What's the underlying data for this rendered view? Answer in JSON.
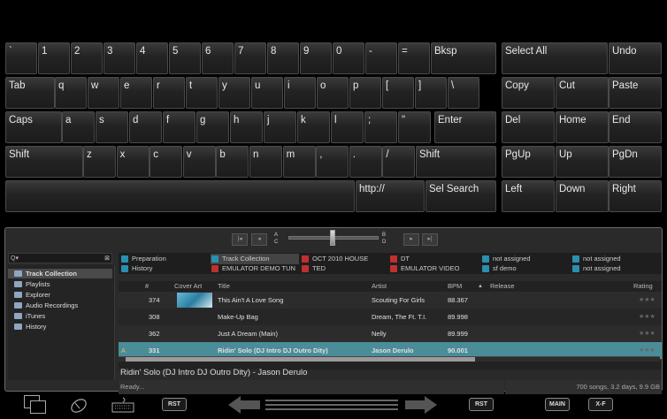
{
  "keyboard": {
    "row1": [
      "`",
      "1",
      "2",
      "3",
      "4",
      "5",
      "6",
      "7",
      "8",
      "9",
      "0",
      "-",
      "=",
      "Bksp"
    ],
    "row2": [
      "Tab",
      "q",
      "w",
      "e",
      "r",
      "t",
      "y",
      "u",
      "i",
      "o",
      "p",
      "[",
      "]",
      "\\"
    ],
    "row3": [
      "Caps",
      "a",
      "s",
      "d",
      "f",
      "g",
      "h",
      "j",
      "k",
      "l",
      ";",
      "\"",
      "Enter"
    ],
    "row4": [
      "Shift",
      "z",
      "x",
      "c",
      "v",
      "b",
      "n",
      "m",
      ",",
      ".",
      "/",
      "Shift"
    ],
    "row5": [
      "",
      "http://",
      "Sel Search"
    ],
    "edit": [
      [
        "Select All",
        "Undo"
      ],
      [
        "Copy",
        "Cut",
        "Paste"
      ],
      [
        "Del",
        "Home",
        "End"
      ],
      [
        "PgUp",
        "Up",
        "PgDn"
      ],
      [
        "Left",
        "Down",
        "Right"
      ]
    ]
  },
  "crossfader": {
    "left_letters": [
      "A",
      "C"
    ],
    "right_letters": [
      "B",
      "D"
    ]
  },
  "search": {
    "placeholder": "Q▾"
  },
  "tree": [
    "Track Collection",
    "Playlists",
    "Explorer",
    "Audio Recordings",
    "iTunes",
    "History"
  ],
  "favorites": [
    {
      "label": "Preparation",
      "color": "#2a8fb0"
    },
    {
      "label": "Track Collection",
      "color": "#2a8fb0"
    },
    {
      "label": "OCT 2010 HOUSE",
      "color": "#c03030"
    },
    {
      "label": "DT",
      "color": "#c03030"
    },
    {
      "label": "not assigned",
      "color": "#2a8fb0"
    },
    {
      "label": "not assigned",
      "color": "#2a8fb0"
    },
    {
      "label": "History",
      "color": "#2a8fb0"
    },
    {
      "label": "EMULATOR DEMO TUN",
      "color": "#c03030"
    },
    {
      "label": "TED",
      "color": "#c03030"
    },
    {
      "label": "EMULATOR VIDEO",
      "color": "#c03030"
    },
    {
      "label": "sf demo",
      "color": "#2a8fb0"
    },
    {
      "label": "not assigned",
      "color": "#2a8fb0"
    }
  ],
  "table": {
    "headers": [
      "#",
      "Cover Art",
      "Title",
      "Artist",
      "BPM",
      "▲",
      "Release",
      "Rating"
    ],
    "rows": [
      {
        "deck": "",
        "num": "374",
        "title": "This Ain't A Love Song",
        "artist": "Scouting For Girls",
        "bpm": "88.367",
        "selected": false
      },
      {
        "deck": "",
        "num": "308",
        "title": "Make-Up Bag",
        "artist": "Dream, The Ft. T.I.",
        "bpm": "89.998",
        "selected": false
      },
      {
        "deck": "",
        "num": "362",
        "title": "Just A Dream (Main)",
        "artist": "Nelly",
        "bpm": "89.999",
        "selected": false
      },
      {
        "deck": "A",
        "num": "331",
        "title": "Ridin' Solo (DJ Intro DJ Outro Dity)",
        "artist": "Jason Derulo",
        "bpm": "90.001",
        "selected": true
      }
    ]
  },
  "now_playing": "Ridin' Solo (DJ Intro DJ Outro Dity) - Jason Derulo",
  "status": {
    "left": "Ready...",
    "right": "700 songs, 3.2 days, 9.9 GB"
  },
  "taskbar": {
    "rst1": "RST",
    "rst2": "RST",
    "main": "MAIN",
    "xf": "X-F"
  },
  "colors": {
    "selected_row": "#4a8d99",
    "accent": "#2a8fb0"
  }
}
